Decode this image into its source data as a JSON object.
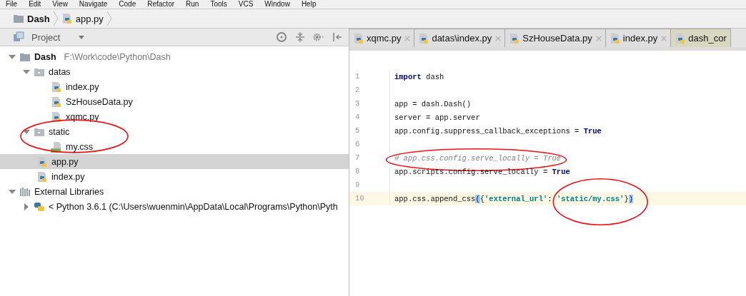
{
  "menu": [
    "File",
    "Edit",
    "View",
    "Navigate",
    "Code",
    "Refactor",
    "Run",
    "Tools",
    "VCS",
    "Window",
    "Help"
  ],
  "breadcrumb": [
    {
      "label": "Dash",
      "kind": "folder"
    },
    {
      "label": "app.py",
      "kind": "python"
    }
  ],
  "project_panel": {
    "title": "Project",
    "tree": [
      {
        "label": "Dash",
        "hint": "F:\\Work\\code\\Python\\Dash",
        "kind": "project",
        "expanded": true,
        "selected": false,
        "children": [
          {
            "label": "datas",
            "kind": "folder",
            "expanded": true,
            "selected": false,
            "children": [
              {
                "label": "index.py",
                "kind": "python",
                "selected": false
              },
              {
                "label": "SzHouseData.py",
                "kind": "python",
                "selected": false
              },
              {
                "label": "xqmc.py",
                "kind": "python",
                "selected": false
              }
            ]
          },
          {
            "label": "static",
            "kind": "folder",
            "expanded": true,
            "selected": false,
            "circled": true,
            "children": [
              {
                "label": "my.css",
                "kind": "css",
                "selected": false
              }
            ]
          },
          {
            "label": "app.py",
            "kind": "python",
            "selected": true
          },
          {
            "label": "index.py",
            "kind": "python",
            "selected": false
          }
        ]
      },
      {
        "label": "External Libraries",
        "kind": "library",
        "expanded": true,
        "selected": false,
        "children": [
          {
            "label": "< Python 3.6.1 (C:\\Users\\wuenmin\\AppData\\Local\\Programs\\Python\\Pyth",
            "kind": "python-sdk",
            "expanded": false,
            "selected": false
          }
        ]
      }
    ]
  },
  "editor": {
    "tabs": [
      {
        "label": "xqmc.py",
        "selected": false,
        "closable": true
      },
      {
        "label": "datas\\index.py",
        "selected": false,
        "closable": true
      },
      {
        "label": "SzHouseData.py",
        "selected": false,
        "closable": true
      },
      {
        "label": "index.py",
        "selected": false,
        "closable": true
      },
      {
        "label": "dash_cor",
        "selected": true,
        "closable": false
      }
    ],
    "lines": [
      {
        "number": "1",
        "current": false,
        "tokens": [
          {
            "kind": "keyword",
            "text": "import"
          },
          {
            "kind": "plain",
            "text": " dash"
          }
        ]
      },
      {
        "number": "2",
        "current": false
      },
      {
        "number": "3",
        "current": false,
        "tokens": [
          {
            "kind": "plain",
            "text": "app = dash.Dash()"
          }
        ]
      },
      {
        "number": "4",
        "current": false,
        "tokens": [
          {
            "kind": "plain",
            "text": "server = app.server"
          }
        ]
      },
      {
        "number": "5",
        "current": false,
        "tokens": [
          {
            "kind": "plain",
            "text": "app.config.suppress_callback_exceptions = "
          },
          {
            "kind": "keyword",
            "text": "True"
          }
        ]
      },
      {
        "number": "6",
        "current": false
      },
      {
        "number": "7",
        "current": false,
        "tokens": [
          {
            "kind": "comment",
            "text": "# app.css.config.serve_locally = True",
            "circled": true
          }
        ]
      },
      {
        "number": "8",
        "current": false,
        "tokens": [
          {
            "kind": "plain",
            "text": "app.scripts.config.serve_locally = "
          },
          {
            "kind": "keyword",
            "text": "True"
          }
        ]
      },
      {
        "number": "9",
        "current": false
      },
      {
        "number": "10",
        "current": true,
        "tokens": [
          {
            "kind": "plain",
            "text": "app.css.append_css"
          },
          {
            "kind": "match",
            "text": "("
          },
          {
            "kind": "plain",
            "text": "{"
          },
          {
            "kind": "string",
            "text": "'external_url'"
          },
          {
            "kind": "plain",
            "text": ": "
          },
          {
            "kind": "string",
            "text": "'static/my.css'",
            "circled": true
          },
          {
            "kind": "plain",
            "text": "}"
          },
          {
            "kind": "match",
            "text": ")"
          }
        ]
      }
    ]
  }
}
